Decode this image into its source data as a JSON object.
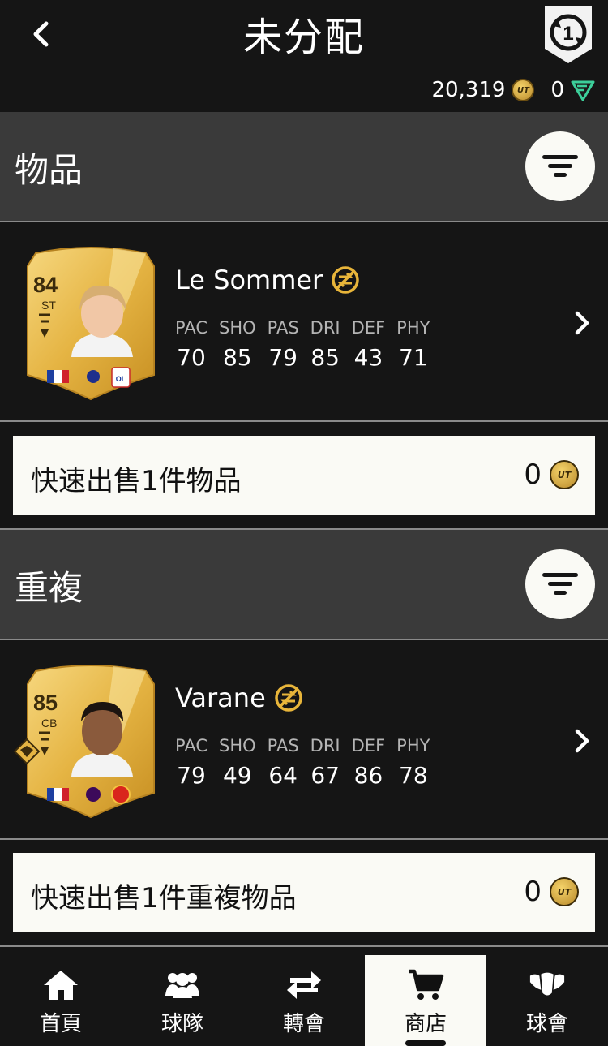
{
  "header": {
    "title": "未分配",
    "coins": "20,319",
    "points": "0",
    "coin_icon": "ut-coin-icon",
    "points_icon": "fc-points-icon"
  },
  "sections": [
    {
      "label": "物品",
      "player": {
        "rating": "84",
        "position": "ST",
        "name": "Le Sommer",
        "stats": [
          {
            "k": "PAC",
            "v": "70"
          },
          {
            "k": "SHO",
            "v": "85"
          },
          {
            "k": "PAS",
            "v": "79"
          },
          {
            "k": "DRI",
            "v": "85"
          },
          {
            "k": "DEF",
            "v": "43"
          },
          {
            "k": "PHY",
            "v": "71"
          }
        ]
      },
      "quick_sell": {
        "label": "快速出售1件物品",
        "value": "0"
      }
    },
    {
      "label": "重複",
      "player": {
        "rating": "85",
        "position": "CB",
        "name": "Varane",
        "stats": [
          {
            "k": "PAC",
            "v": "79"
          },
          {
            "k": "SHO",
            "v": "49"
          },
          {
            "k": "PAS",
            "v": "64"
          },
          {
            "k": "DRI",
            "v": "67"
          },
          {
            "k": "DEF",
            "v": "86"
          },
          {
            "k": "PHY",
            "v": "78"
          }
        ]
      },
      "quick_sell": {
        "label": "快速出售1件重複物品",
        "value": "0"
      }
    }
  ],
  "coin_text": "UT",
  "nav": [
    {
      "label": "首頁",
      "icon": "home-icon"
    },
    {
      "label": "球隊",
      "icon": "squad-icon"
    },
    {
      "label": "轉會",
      "icon": "transfers-icon"
    },
    {
      "label": "商店",
      "icon": "store-icon",
      "active": true
    },
    {
      "label": "球會",
      "icon": "club-icon"
    }
  ],
  "colors": {
    "background": "#151515",
    "section_bg": "#3a3a3a",
    "panel_light": "#fafaf5",
    "gold": "#e8b53a"
  }
}
